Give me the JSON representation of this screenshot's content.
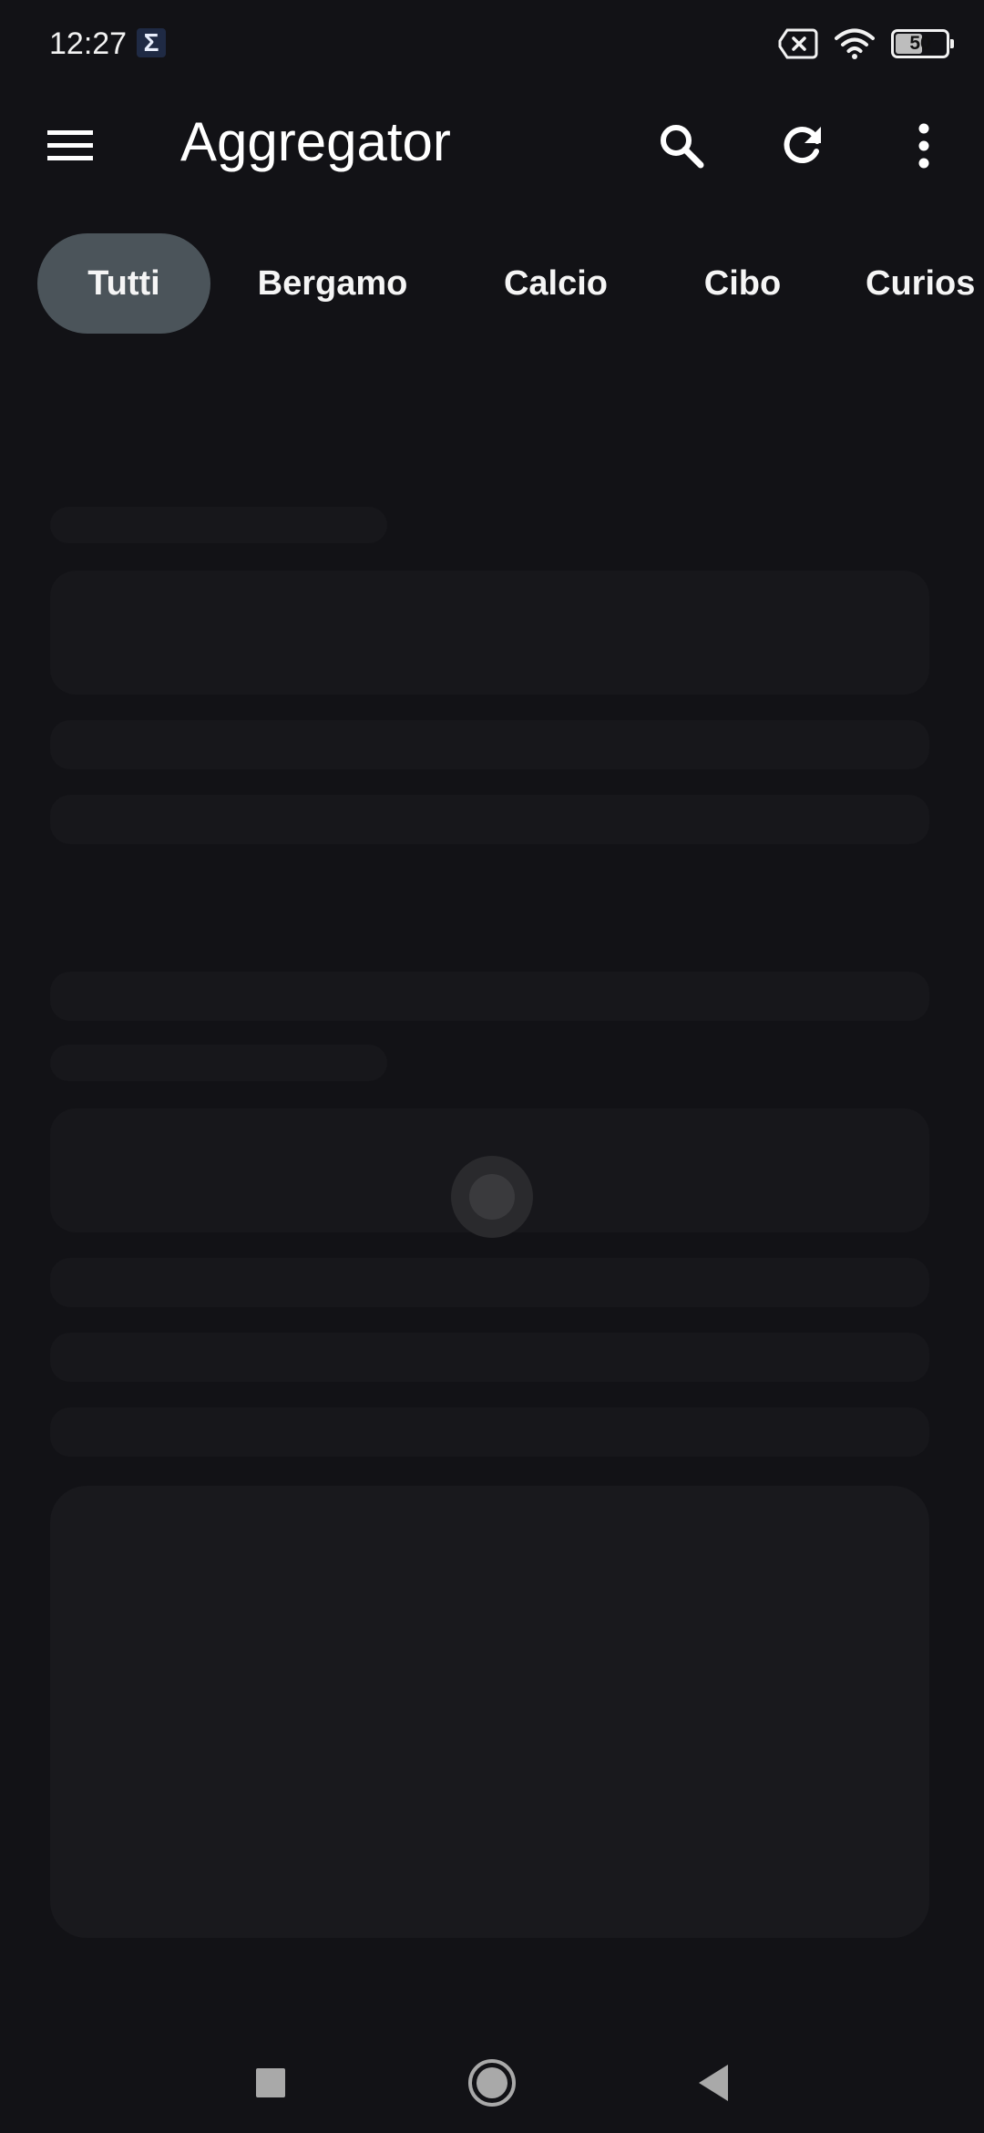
{
  "status_bar": {
    "time": "12:27",
    "app_icon_glyph": "Σ",
    "battery_level": "50",
    "icons": [
      "sigma-app-icon",
      "no-sim-icon",
      "wifi-icon",
      "battery-icon"
    ]
  },
  "app_bar": {
    "title": "Aggregator",
    "icons": [
      "menu-icon",
      "search-icon",
      "refresh-icon",
      "more-vert-icon"
    ]
  },
  "tabs": [
    {
      "label": "Tutti",
      "active": true
    },
    {
      "label": "Bergamo",
      "active": false
    },
    {
      "label": "Calcio",
      "active": false
    },
    {
      "label": "Cibo",
      "active": false
    },
    {
      "label": "Curios",
      "active": false
    }
  ],
  "content": {
    "state": "loading"
  },
  "nav_bar": {
    "icons": [
      "recents-square-icon",
      "home-circle-icon",
      "back-triangle-icon"
    ]
  },
  "colors": {
    "background": "#121216",
    "active_tab": "#4b545a",
    "skeleton": "#17171b",
    "text": "#ffffff"
  }
}
